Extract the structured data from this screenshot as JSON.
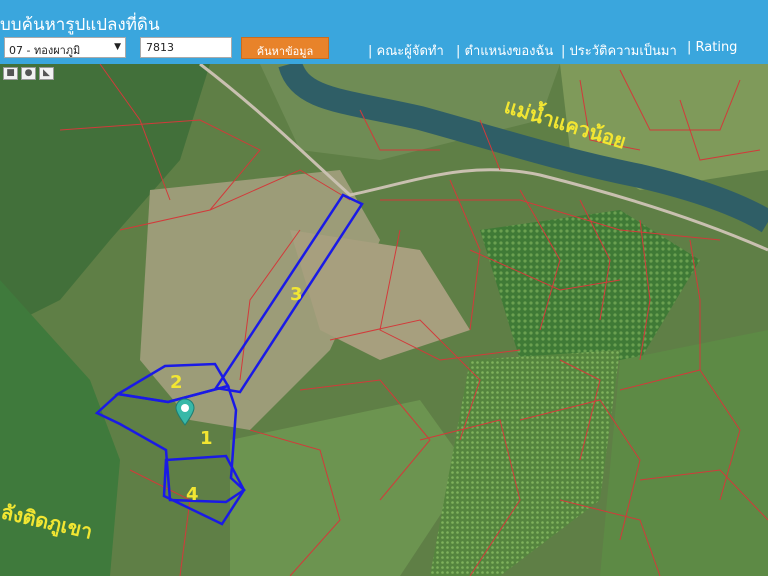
{
  "header": {
    "title": "บบค้นหารูปแปลงที่ดิน",
    "district_select": "07 - ทองผาภูมิ",
    "parcel_input": "7813",
    "search_button": "ค้นหาข้อมูล",
    "nav": [
      "คณะผู้จัดทำ",
      "ตำแหน่งของฉัน",
      "ประวัติความเป็นมา",
      "Rating"
    ]
  },
  "tools": [
    {
      "icon": "square-draw-icon",
      "glyph": "■"
    },
    {
      "icon": "circle-draw-icon",
      "glyph": "●"
    },
    {
      "icon": "polygon-draw-icon",
      "glyph": "◣"
    }
  ],
  "map": {
    "river_label": "แม่น้ำแควน้อย",
    "mountain_label": "ลังติดภูเขา",
    "plot_labels": [
      "1",
      "2",
      "3",
      "4"
    ],
    "colors": {
      "plot_outline": "#1a1ae6",
      "plot_label": "#f2e632",
      "parcel_lines": "#d23a3a",
      "marker": "#38b8a8"
    }
  }
}
